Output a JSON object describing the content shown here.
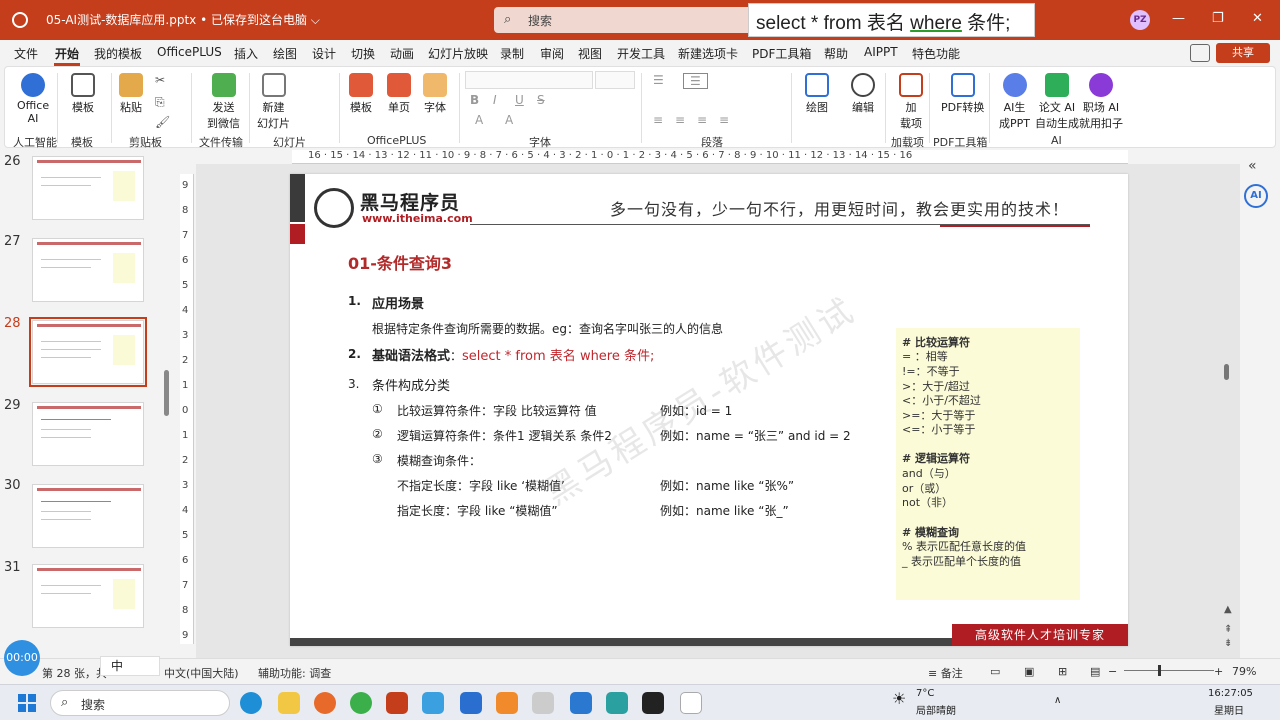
{
  "titlebar": {
    "doc_title": "05-AI测试-数据库应用.pptx  •  已保存到这台电脑 ⌵",
    "search_placeholder": "搜索",
    "sql_popup": {
      "part1": "select * from 表名 ",
      "part2": "where",
      "part3": " 条件;"
    },
    "avatar": "PZ"
  },
  "menu": {
    "items": [
      "文件",
      "开始",
      "我的模板",
      "OfficePLUS",
      "插入",
      "绘图",
      "设计",
      "切换",
      "动画",
      "幻灯片放映",
      "录制",
      "审阅",
      "视图",
      "开发工具",
      "新建选项卡",
      "PDF工具箱",
      "帮助",
      "AIPPT",
      "特色功能"
    ],
    "share": "共享"
  },
  "ribbon": {
    "buttons": {
      "office_ai": "Office\nAI",
      "template": "模板",
      "paste": "粘贴",
      "send_wechat": "发送\n到微信",
      "new_slide": "新建\n幻灯片",
      "opl_template": "模板",
      "single_page": "单页",
      "font_btn": "字体",
      "draw": "绘图",
      "edit": "编辑",
      "addins": "加\n载项",
      "pdf_convert": "PDF转换",
      "ai_ppt": "AI生\n成PPT",
      "paper_ai": "论文 AI\n自动生成",
      "career_ai": "职场 AI\n就用扣子"
    },
    "groups": {
      "ai_smart": "人工智能",
      "templates": "模板",
      "clipboard": "剪贴板",
      "file_transfer": "文件传输",
      "slides": "幻灯片",
      "officeplus": "OfficePLUS",
      "font": "字体",
      "paragraph": "段落",
      "addins": "加载项",
      "pdf_tools": "PDF工具箱",
      "ai": "AI"
    }
  },
  "thumbnails": [
    {
      "num": "26"
    },
    {
      "num": "27"
    },
    {
      "num": "28"
    },
    {
      "num": "29"
    },
    {
      "num": "30"
    },
    {
      "num": "31"
    }
  ],
  "ruler": {
    "h": "16 · 15 · 14 · 13 · 12 · 11 · 10 · 9 · 8 · 7 · 6 · 5 · 4 · 3 · 2 · 1 · 0 · 1 · 2 · 3 · 4 · 5 · 6 · 7 · 8 · 9 · 10 · 11 · 12 · 13 · 14 · 15 · 16",
    "v": [
      "9",
      "8",
      "7",
      "6",
      "5",
      "4",
      "3",
      "2",
      "1",
      "0",
      "1",
      "2",
      "3",
      "4",
      "5",
      "6",
      "7",
      "8",
      "9"
    ]
  },
  "slide": {
    "logo_name": "黑马程序员",
    "logo_url": "www.itheima.com",
    "slogan": "多一句没有，少一句不行，用更短时间，教会更实用的技术！",
    "title": "01-条件查询3",
    "s1_num": "1.",
    "s1_title": "应用场景",
    "s1_desc": "根据特定条件查询所需要的数据。eg：查询名字叫张三的人的信息",
    "s2_num": "2.",
    "s2_title": "基础语法格式",
    "s2_colon": "：",
    "s2_sql": "select * from 表名 where 条件;",
    "s3_num": "3.",
    "s3_title": "条件构成分类",
    "items": [
      {
        "mark": "①",
        "text": "比较运算符条件：字段  比较运算符  值",
        "example": "例如：id = 1"
      },
      {
        "mark": "②",
        "text": "逻辑运算符条件：条件1 逻辑关系 条件2",
        "example": "例如：name = “张三”  and id = 2"
      },
      {
        "mark": "③",
        "text": "模糊查询条件：",
        "example": ""
      }
    ],
    "fuzzy1": "不指定长度：字段 like ‘模糊值’",
    "fuzzy1_ex": "例如：name like  “张%”",
    "fuzzy2": "指定长度：字段  like  “模糊值”",
    "fuzzy2_ex": "例如：name like  “张_”",
    "watermark": "黑马程序员-软件测试",
    "note": [
      "# 比较运算符",
      "= ：相等",
      "!=：不等于",
      ">：大于/超过",
      "<：小于/不超过",
      ">=：大于等于",
      "<=：小于等于",
      "",
      "# 逻辑运算符",
      "and（与）",
      "or（或）",
      "not（非）",
      "",
      "# 模糊查询",
      "% 表示匹配任意长度的值",
      "_ 表示匹配单个长度的值"
    ],
    "footer": "高级软件人才培训专家"
  },
  "statusbar": {
    "slide_info": "第 28 张，共",
    "lang": "中文(中国大陆)",
    "accessibility": "辅助功能: 调查",
    "notes": "备注",
    "zoom": "79%",
    "timer": "00:00",
    "ime": "中"
  },
  "taskbar": {
    "search": "搜索",
    "weather_temp": "7°C",
    "weather_desc": "局部晴朗",
    "time": "16:27:05",
    "day": "星期日"
  }
}
